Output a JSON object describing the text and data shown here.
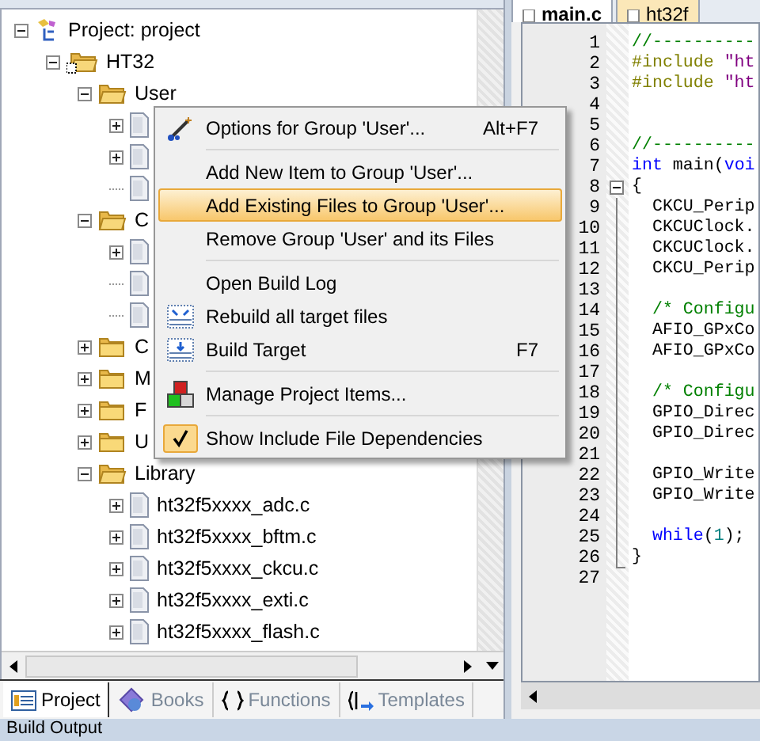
{
  "project_panel": {
    "tree": [
      {
        "label": "Project: project",
        "kind": "project",
        "expanded": true,
        "children": [
          {
            "label": "HT32",
            "kind": "target",
            "expanded": true,
            "children": [
              {
                "label": "User",
                "kind": "group",
                "expanded": true,
                "children": [
                  {
                    "kind": "file",
                    "expanded": false
                  },
                  {
                    "kind": "file",
                    "expanded": false
                  },
                  {
                    "kind": "file"
                  }
                ]
              },
              {
                "label": "C",
                "kind": "group",
                "expanded": true,
                "children": [
                  {
                    "kind": "file",
                    "expanded": false
                  },
                  {
                    "kind": "file"
                  },
                  {
                    "kind": "file"
                  }
                ]
              },
              {
                "label": "C",
                "kind": "group",
                "expanded": false
              },
              {
                "label": "M",
                "kind": "group",
                "expanded": false
              },
              {
                "label": "F",
                "kind": "group",
                "expanded": false
              },
              {
                "label": "U",
                "kind": "group",
                "expanded": false
              },
              {
                "label": "Library",
                "kind": "group",
                "expanded": true,
                "children": [
                  {
                    "label": "ht32f5xxxx_adc.c",
                    "kind": "file",
                    "expanded": false
                  },
                  {
                    "label": "ht32f5xxxx_bftm.c",
                    "kind": "file",
                    "expanded": false
                  },
                  {
                    "label": "ht32f5xxxx_ckcu.c",
                    "kind": "file",
                    "expanded": false
                  },
                  {
                    "label": "ht32f5xxxx_exti.c",
                    "kind": "file",
                    "expanded": false
                  },
                  {
                    "label": "ht32f5xxxx_flash.c",
                    "kind": "file",
                    "expanded": false
                  }
                ]
              }
            ]
          }
        ]
      }
    ],
    "tabs": [
      {
        "label": "Project",
        "selected": true
      },
      {
        "label": "Books",
        "selected": false
      },
      {
        "label": "Functions",
        "selected": false
      },
      {
        "label": "Templates",
        "selected": false
      }
    ]
  },
  "context_menu": {
    "items": [
      {
        "kind": "item",
        "label": "Options for Group 'User'...",
        "shortcut": "Alt+F7",
        "selected": false,
        "checked": false
      },
      {
        "kind": "separator"
      },
      {
        "kind": "item",
        "label": "Add New  Item to Group 'User'...",
        "selected": false,
        "checked": false
      },
      {
        "kind": "item",
        "label": "Add Existing Files to Group 'User'...",
        "selected": true,
        "checked": false
      },
      {
        "kind": "item",
        "label": "Remove Group 'User' and its Files",
        "selected": false,
        "checked": false
      },
      {
        "kind": "separator"
      },
      {
        "kind": "item",
        "label": "Open Build Log",
        "selected": false,
        "checked": false
      },
      {
        "kind": "item",
        "label": "Rebuild all target files",
        "selected": false,
        "checked": false
      },
      {
        "kind": "item",
        "label": "Build Target",
        "shortcut": "F7",
        "selected": false,
        "checked": false
      },
      {
        "kind": "separator"
      },
      {
        "kind": "item",
        "label": "Manage Project Items...",
        "selected": false,
        "checked": false
      },
      {
        "kind": "separator"
      },
      {
        "kind": "item",
        "label": "Show Include File Dependencies",
        "selected": false,
        "checked": true
      }
    ]
  },
  "editor": {
    "tabs": [
      {
        "label": "main.c",
        "selected": true
      },
      {
        "label": "ht32f",
        "selected": false
      }
    ],
    "lines": [
      {
        "number": "1",
        "code": [
          {
            "kind": "comment",
            "text": "//----------"
          }
        ]
      },
      {
        "number": "2",
        "code": [
          {
            "kind": "directive",
            "text": "#include "
          },
          {
            "kind": "string",
            "text": "\"ht"
          }
        ]
      },
      {
        "number": "3",
        "code": [
          {
            "kind": "directive",
            "text": "#include "
          },
          {
            "kind": "string",
            "text": "\"ht"
          }
        ]
      },
      {
        "number": "4"
      },
      {
        "number": "5"
      },
      {
        "number": "6",
        "code": [
          {
            "kind": "comment",
            "text": "//----------"
          }
        ]
      },
      {
        "number": "7",
        "code": [
          {
            "kind": "keyword",
            "text": "int"
          },
          {
            "kind": "plain",
            "text": " main("
          },
          {
            "kind": "keyword",
            "text": "voi"
          }
        ]
      },
      {
        "number": "8",
        "fold_start": true,
        "code": [
          {
            "kind": "plain",
            "text": "{"
          }
        ]
      },
      {
        "number": "9",
        "code": [
          {
            "kind": "plain",
            "text": "  CKCU_Perip"
          }
        ]
      },
      {
        "number": "10",
        "code": [
          {
            "kind": "plain",
            "text": "  CKCUClock."
          }
        ]
      },
      {
        "number": "11",
        "code": [
          {
            "kind": "plain",
            "text": "  CKCUClock."
          }
        ]
      },
      {
        "number": "12",
        "code": [
          {
            "kind": "plain",
            "text": "  CKCU_Perip"
          }
        ]
      },
      {
        "number": "13"
      },
      {
        "number": "14",
        "code": [
          {
            "kind": "comment",
            "text": "  /* Configu"
          }
        ]
      },
      {
        "number": "15",
        "code": [
          {
            "kind": "plain",
            "text": "  AFIO_GPxCo"
          }
        ]
      },
      {
        "number": "16",
        "code": [
          {
            "kind": "plain",
            "text": "  AFIO_GPxCo"
          }
        ]
      },
      {
        "number": "17"
      },
      {
        "number": "18",
        "code": [
          {
            "kind": "comment",
            "text": "  /* Configu"
          }
        ]
      },
      {
        "number": "19",
        "code": [
          {
            "kind": "plain",
            "text": "  GPIO_Direc"
          }
        ]
      },
      {
        "number": "20",
        "code": [
          {
            "kind": "plain",
            "text": "  GPIO_Direc"
          }
        ]
      },
      {
        "number": "21"
      },
      {
        "number": "22",
        "code": [
          {
            "kind": "plain",
            "text": "  GPIO_Write"
          }
        ]
      },
      {
        "number": "23",
        "code": [
          {
            "kind": "plain",
            "text": "  GPIO_Write"
          }
        ]
      },
      {
        "number": "24"
      },
      {
        "number": "25",
        "code": [
          {
            "kind": "keyword",
            "text": "  while"
          },
          {
            "kind": "plain",
            "text": "("
          },
          {
            "kind": "number",
            "text": "1"
          },
          {
            "kind": "plain",
            "text": ");"
          }
        ]
      },
      {
        "number": "26",
        "fold_end": true,
        "code": [
          {
            "kind": "plain",
            "text": "}"
          }
        ]
      },
      {
        "number": "27"
      }
    ]
  },
  "build_output": {
    "title": "Build Output"
  }
}
